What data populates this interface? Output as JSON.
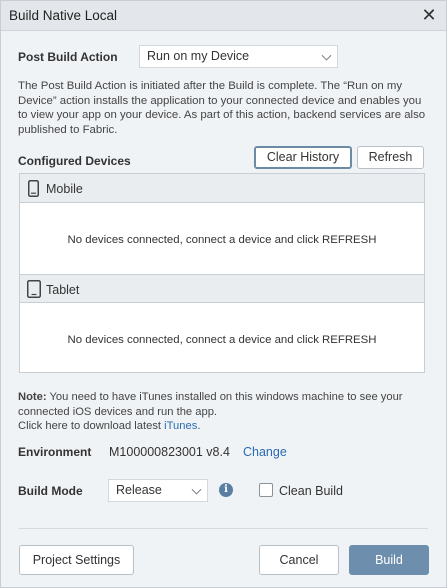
{
  "window": {
    "title": "Build Native Local",
    "close_glyph": "✕"
  },
  "post_build": {
    "label": "Post Build Action",
    "selected": "Run on my Device",
    "description": "The Post Build Action is initiated after the Build is complete. The “Run on my Device” action installs the application to your connected device and enables you to view your app on your device. As part of this action, backend services are also published to Fabric."
  },
  "devices": {
    "heading": "Configured Devices",
    "clear_history_label": "Clear History",
    "refresh_label": "Refresh",
    "groups": [
      {
        "name": "Mobile",
        "icon": "phone-icon",
        "message": "No devices connected, connect a device and click REFRESH"
      },
      {
        "name": "Tablet",
        "icon": "tablet-icon",
        "message": "No devices connected, connect a device and click REFRESH"
      }
    ]
  },
  "note": {
    "prefix": "Note:",
    "text": " You need to have iTunes installed on this windows machine to see your connected iOS devices and run the app.",
    "download_text": "Click here to download latest ",
    "itunes_link": "iTunes",
    "suffix": "."
  },
  "environment": {
    "label": "Environment",
    "value": "M100000823001 v8.4",
    "change_link": "Change"
  },
  "build_mode": {
    "label": "Build Mode",
    "selected": "Release",
    "info_glyph": "i",
    "clean_build_label": "Clean Build",
    "clean_build_checked": false
  },
  "footer": {
    "project_settings_label": "Project Settings",
    "cancel_label": "Cancel",
    "build_label": "Build"
  },
  "colors": {
    "primary_button": "#6d8fad",
    "link": "#2a6bb1",
    "title_bar": "#e3e7eb"
  }
}
